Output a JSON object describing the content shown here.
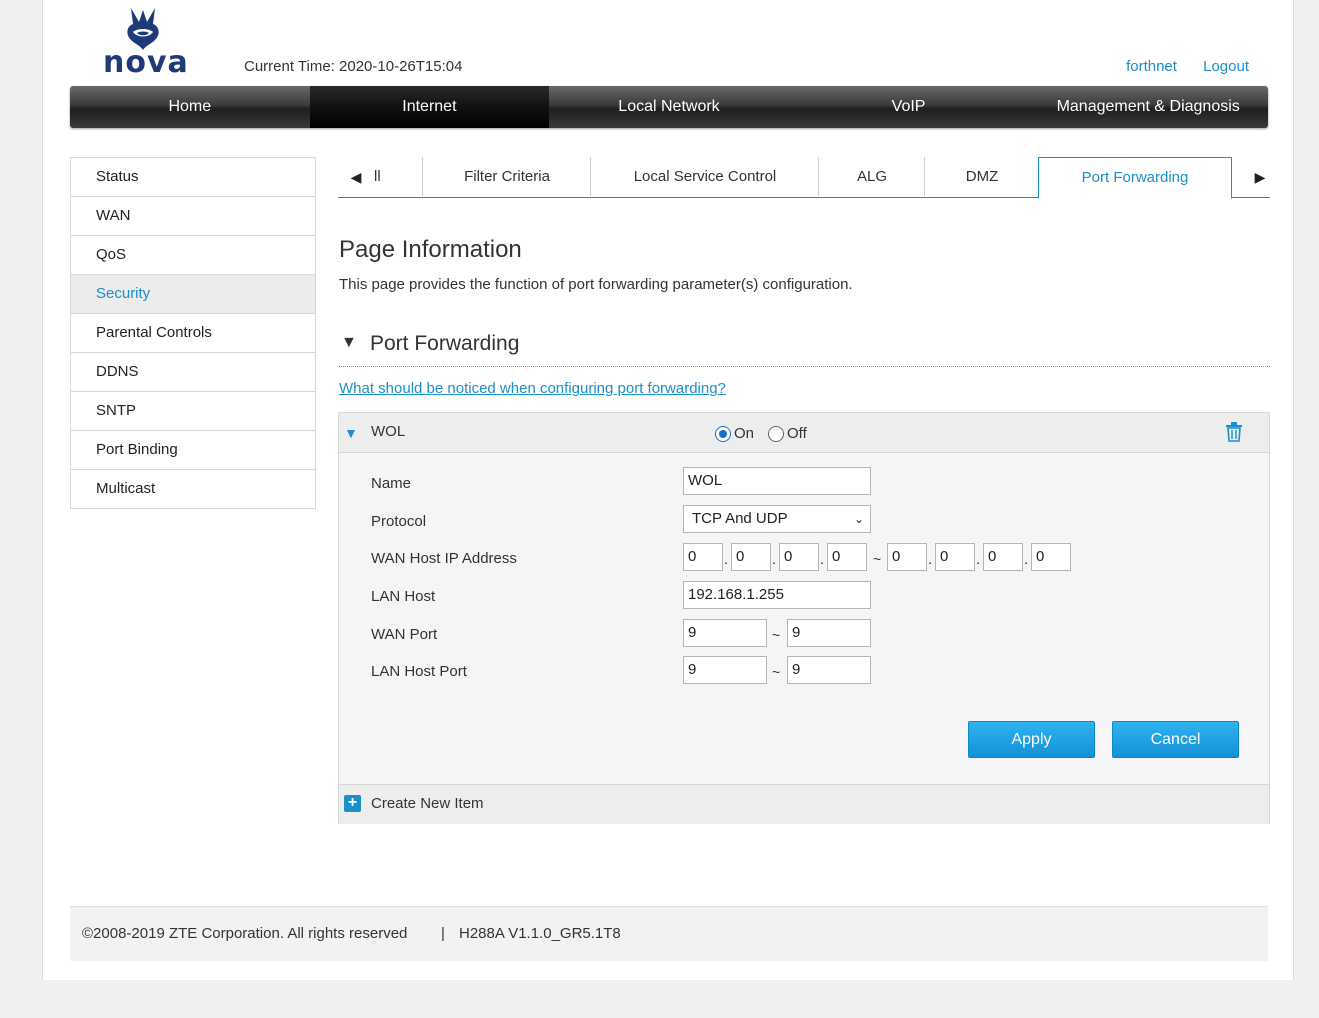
{
  "header": {
    "logo_text": "nova",
    "current_time_label": "Current Time: 2020-10-26T15:04",
    "user_link": "forthnet",
    "logout_link": "Logout"
  },
  "topnav": {
    "items": [
      "Home",
      "Internet",
      "Local Network",
      "VoIP",
      "Management & Diagnosis"
    ],
    "active": "Internet"
  },
  "sidebar": {
    "items": [
      "Status",
      "WAN",
      "QoS",
      "Security",
      "Parental Controls",
      "DDNS",
      "SNTP",
      "Port Binding",
      "Multicast"
    ],
    "active": "Security"
  },
  "tabs": {
    "items": [
      "ll",
      "Filter Criteria",
      "Local Service Control",
      "ALG",
      "DMZ",
      "Port Forwarding"
    ],
    "active": "Port Forwarding"
  },
  "page_info": {
    "title": "Page Information",
    "description": "This page provides the function of port forwarding parameter(s) configuration."
  },
  "section": {
    "title": "Port Forwarding",
    "notice_link": "What should be noticed when configuring port forwarding?"
  },
  "rule": {
    "name": "WOL",
    "on_label": "On",
    "off_label": "Off",
    "enabled": "On",
    "fields": {
      "name_label": "Name",
      "name_value": "WOL",
      "protocol_label": "Protocol",
      "protocol_value": "TCP And UDP",
      "wan_ip_label": "WAN Host IP Address",
      "wan_ip_start": [
        "0",
        "0",
        "0",
        "0"
      ],
      "wan_ip_end": [
        "0",
        "0",
        "0",
        "0"
      ],
      "lan_host_label": "LAN Host",
      "lan_host_value": "192.168.1.255",
      "wan_port_label": "WAN Port",
      "wan_port_start": "9",
      "wan_port_end": "9",
      "lan_port_label": "LAN Host Port",
      "lan_port_start": "9",
      "lan_port_end": "9"
    },
    "range_separator": "~",
    "ip_separator": ".",
    "apply_label": "Apply",
    "cancel_label": "Cancel"
  },
  "create_new_label": "Create New Item",
  "footer": {
    "copyright": "©2008-2019 ZTE Corporation. All rights reserved",
    "separator": "|",
    "version": "H288A V1.1.0_GR5.1T8"
  },
  "colors": {
    "accent": "#1a8fc9",
    "button": "#1391d6",
    "nav_bg": "#2a2a2a"
  }
}
